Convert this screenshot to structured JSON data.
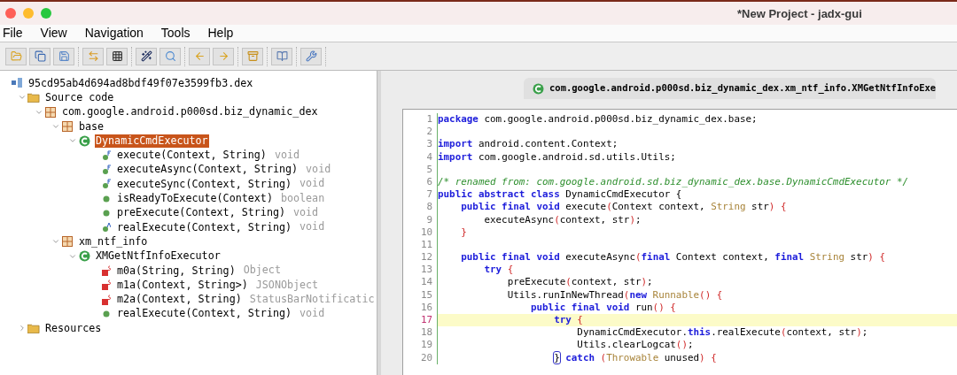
{
  "window": {
    "title": "*New Project - jadx-gui"
  },
  "menu": [
    "File",
    "View",
    "Navigation",
    "Tools",
    "Help"
  ],
  "tree": {
    "label": "95cd95ab4d694ad8bdf49f07e3599fb3.dex",
    "kind": "dex",
    "children": [
      {
        "label": "Source code",
        "kind": "folder",
        "expanded": true,
        "children": [
          {
            "label": "com.google.android.p000sd.biz_dynamic_dex",
            "kind": "package",
            "expanded": true,
            "children": [
              {
                "label": "base",
                "kind": "package",
                "expanded": true,
                "children": [
                  {
                    "label": "DynamicCmdExecutor",
                    "kind": "class",
                    "expanded": true,
                    "selected": true,
                    "children": [
                      {
                        "label": "execute(Context, String)",
                        "returns": "void",
                        "kind": "final",
                        "selected": false
                      },
                      {
                        "label": "executeAsync(Context, String)",
                        "returns": "void",
                        "kind": "final",
                        "selected": false
                      },
                      {
                        "label": "executeSync(Context, String)",
                        "returns": "void",
                        "kind": "final",
                        "selected": false
                      },
                      {
                        "label": "isReadyToExecute(Context)",
                        "returns": "boolean",
                        "kind": "public",
                        "selected": false
                      },
                      {
                        "label": "preExecute(Context, String)",
                        "returns": "void",
                        "kind": "public",
                        "selected": false
                      },
                      {
                        "label": "realExecute(Context, String)",
                        "returns": "void",
                        "kind": "abstract",
                        "selected": false
                      }
                    ]
                  }
                ]
              },
              {
                "label": "xm_ntf_info",
                "kind": "package",
                "expanded": true,
                "children": [
                  {
                    "label": "XMGetNtfInfoExecutor",
                    "kind": "class",
                    "expanded": true,
                    "selected": false,
                    "children": [
                      {
                        "label": "m0a(String, String)",
                        "returns": "Object",
                        "kind": "static",
                        "selected": false
                      },
                      {
                        "label": "m1a(Context, String>)",
                        "returns": "JSONObject",
                        "kind": "static",
                        "selected": false
                      },
                      {
                        "label": "m2a(Context, String)",
                        "returns": "StatusBarNotificatic",
                        "kind": "static",
                        "selected": false
                      },
                      {
                        "label": "realExecute(Context, String)",
                        "returns": "void",
                        "kind": "public",
                        "selected": false
                      }
                    ]
                  }
                ]
              }
            ]
          }
        ]
      },
      {
        "label": "Resources",
        "kind": "folder",
        "expanded": false
      }
    ]
  },
  "editor_tab": {
    "title": "com.google.android.p000sd.biz_dynamic_dex.xm_ntf_info.XMGetNtfInfoExe"
  },
  "code": [
    {
      "number": "1",
      "highlighted": false,
      "tokens": [
        {
          "text": "package",
          "kind": "kw"
        },
        {
          "text": " com.google.android.p000sd.biz_dynamic_dex.base;",
          "kind": "plain"
        }
      ]
    },
    {
      "number": "2",
      "highlighted": false
    },
    {
      "number": "3",
      "highlighted": false,
      "tokens": [
        {
          "text": "import",
          "kind": "kw"
        },
        {
          "text": " android.content.Context;",
          "kind": "plain"
        }
      ]
    },
    {
      "number": "4",
      "highlighted": false,
      "tokens": [
        {
          "text": "import",
          "kind": "kw"
        },
        {
          "text": " com.google.android.sd.utils.Utils;",
          "kind": "plain"
        }
      ]
    },
    {
      "number": "5",
      "highlighted": false
    },
    {
      "number": "6",
      "highlighted": false,
      "tokens": [
        {
          "text": "/* renamed from: com.google.android.sd.biz_dynamic_dex.base.DynamicCmdExecutor */",
          "kind": "comment"
        }
      ]
    },
    {
      "number": "7",
      "highlighted": false,
      "tokens": [
        {
          "text": "public abstract class",
          "kind": "kw"
        },
        {
          "text": " DynamicCmdExecutor {",
          "kind": "plain"
        }
      ]
    },
    {
      "number": "8",
      "highlighted": false,
      "tokens": [
        {
          "text": "    public final void",
          "kind": "kw"
        },
        {
          "text": " execute",
          "kind": "plain"
        },
        {
          "text": "(",
          "kind": "punct"
        },
        {
          "text": "Context context, ",
          "kind": "plain"
        },
        {
          "text": "String",
          "kind": "type"
        },
        {
          "text": " str",
          "kind": "plain"
        },
        {
          "text": ")",
          "kind": "punct"
        },
        {
          "text": " {",
          "kind": "punct"
        }
      ]
    },
    {
      "number": "9",
      "highlighted": false,
      "tokens": [
        {
          "text": "        executeAsync",
          "kind": "plain"
        },
        {
          "text": "(",
          "kind": "punct"
        },
        {
          "text": "context, str",
          "kind": "plain"
        },
        {
          "text": ")",
          "kind": "punct"
        },
        {
          "text": ";",
          "kind": "plain"
        }
      ]
    },
    {
      "number": "10",
      "highlighted": false,
      "tokens": [
        {
          "text": "    }",
          "kind": "punct"
        }
      ]
    },
    {
      "number": "11",
      "highlighted": false
    },
    {
      "number": "12",
      "highlighted": false,
      "tokens": [
        {
          "text": "    public final void",
          "kind": "kw"
        },
        {
          "text": " executeAsync",
          "kind": "plain"
        },
        {
          "text": "(",
          "kind": "punct"
        },
        {
          "text": "final",
          "kind": "kw"
        },
        {
          "text": " Context context, ",
          "kind": "plain"
        },
        {
          "text": "final",
          "kind": "kw"
        },
        {
          "text": " String",
          "kind": "type"
        },
        {
          "text": " str",
          "kind": "plain"
        },
        {
          "text": ")",
          "kind": "punct"
        },
        {
          "text": " {",
          "kind": "punct"
        }
      ]
    },
    {
      "number": "13",
      "highlighted": false,
      "tokens": [
        {
          "text": "        try",
          "kind": "kw"
        },
        {
          "text": " {",
          "kind": "punct"
        }
      ]
    },
    {
      "number": "14",
      "highlighted": false,
      "tokens": [
        {
          "text": "            preExecute",
          "kind": "plain"
        },
        {
          "text": "(",
          "kind": "punct"
        },
        {
          "text": "context, str",
          "kind": "plain"
        },
        {
          "text": ")",
          "kind": "punct"
        },
        {
          "text": ";",
          "kind": "plain"
        }
      ]
    },
    {
      "number": "15",
      "highlighted": false,
      "tokens": [
        {
          "text": "            Utils.runInNewThread",
          "kind": "plain"
        },
        {
          "text": "(",
          "kind": "punct"
        },
        {
          "text": "new",
          "kind": "kw"
        },
        {
          "text": " Runnable",
          "kind": "type"
        },
        {
          "text": "()",
          "kind": "punct"
        },
        {
          "text": " {",
          "kind": "punct"
        }
      ]
    },
    {
      "number": "16",
      "highlighted": false,
      "tokens": [
        {
          "text": "                public final void",
          "kind": "kw"
        },
        {
          "text": " run",
          "kind": "plain"
        },
        {
          "text": "()",
          "kind": "punct"
        },
        {
          "text": " {",
          "kind": "punct"
        }
      ]
    },
    {
      "number": "17",
      "highlighted": true,
      "tokens": [
        {
          "text": "                    try",
          "kind": "kw"
        },
        {
          "text": " {",
          "kind": "punct"
        }
      ]
    },
    {
      "number": "18",
      "highlighted": false,
      "tokens": [
        {
          "text": "                        DynamicCmdExecutor.",
          "kind": "plain"
        },
        {
          "text": "this",
          "kind": "kw"
        },
        {
          "text": ".realExecute",
          "kind": "plain"
        },
        {
          "text": "(",
          "kind": "punct"
        },
        {
          "text": "context, str",
          "kind": "plain"
        },
        {
          "text": ")",
          "kind": "punct"
        },
        {
          "text": ";",
          "kind": "plain"
        }
      ]
    },
    {
      "number": "19",
      "highlighted": false,
      "tokens": [
        {
          "text": "                        Utils.clearLogcat",
          "kind": "plain"
        },
        {
          "text": "()",
          "kind": "punct"
        },
        {
          "text": ";",
          "kind": "plain"
        }
      ]
    },
    {
      "number": "20",
      "highlighted": false,
      "tokens": [
        {
          "text": "                    }",
          "kind": "match"
        },
        {
          "text": " catch",
          "kind": "kw"
        },
        {
          "text": " (",
          "kind": "punct"
        },
        {
          "text": "Throwable",
          "kind": "type"
        },
        {
          "text": " unused",
          "kind": "plain"
        },
        {
          "text": ")",
          "kind": "punct"
        },
        {
          "text": " {",
          "kind": "punct"
        }
      ]
    }
  ]
}
